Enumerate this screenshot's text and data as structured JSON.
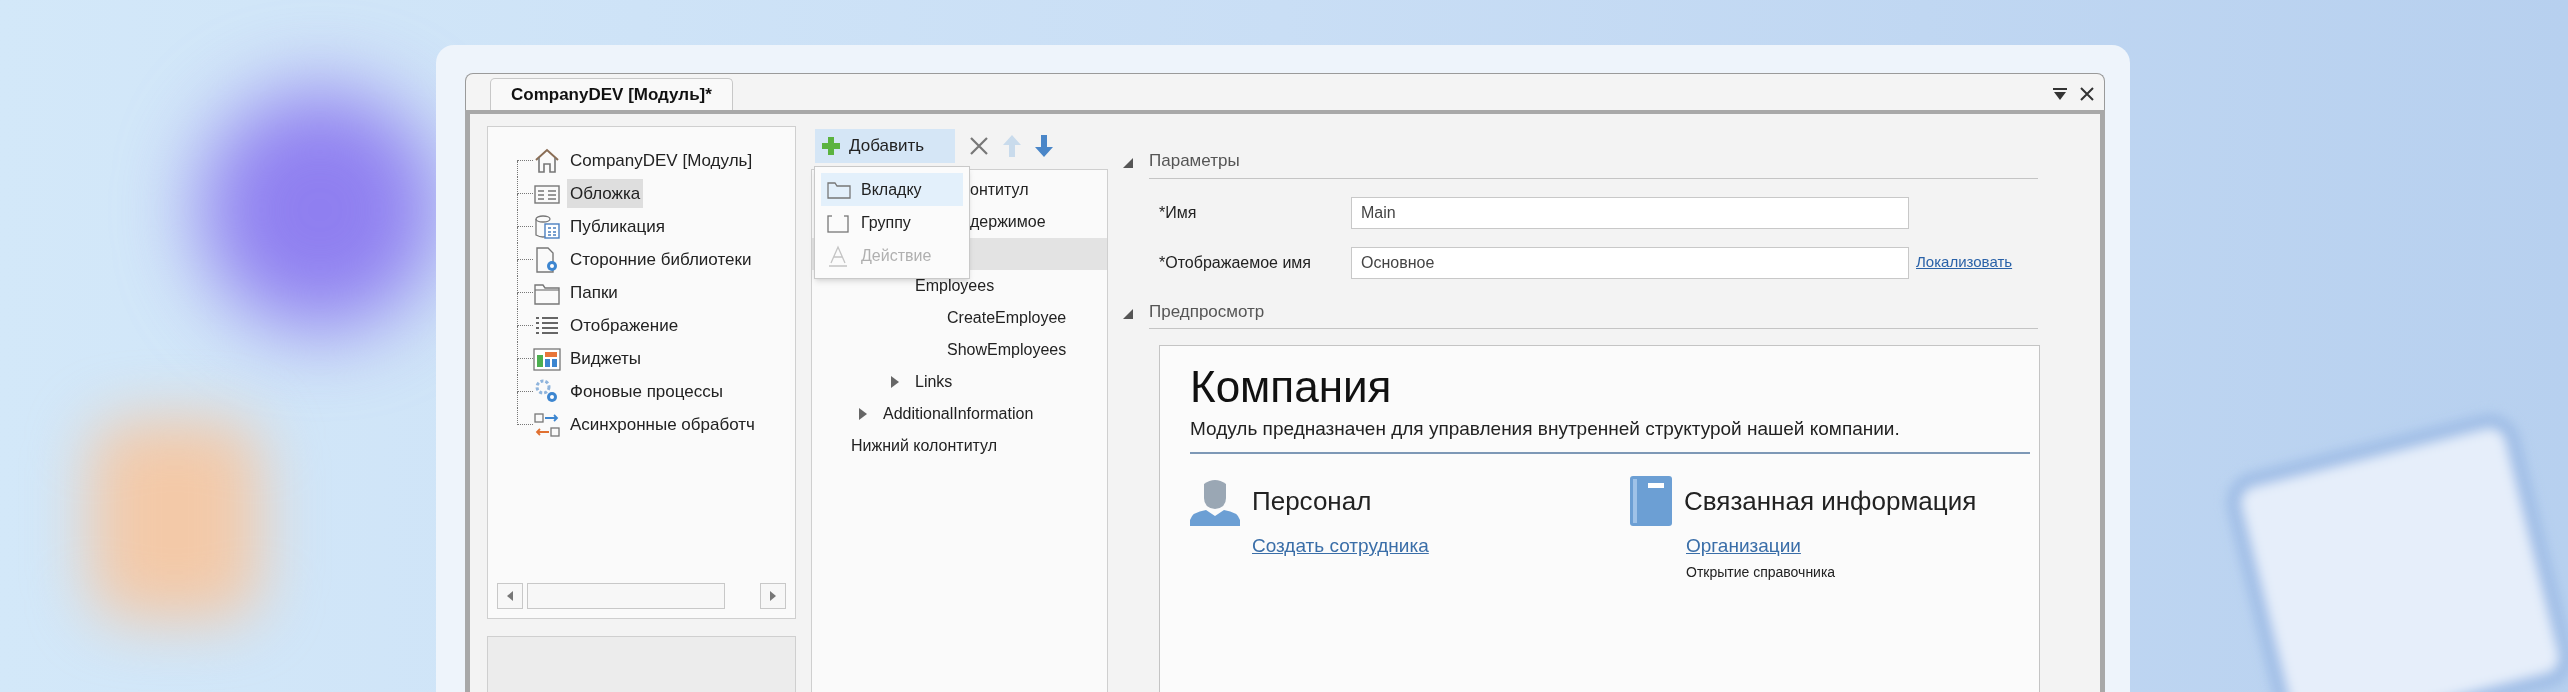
{
  "window": {
    "tab_title": "CompanyDEV [Модуль]*"
  },
  "module_tree": {
    "items": [
      {
        "label": "CompanyDEV [Модуль]",
        "kind": "module",
        "selected": false
      },
      {
        "label": "Обложка",
        "kind": "cover",
        "selected": true
      },
      {
        "label": "Публикация",
        "kind": "publication",
        "selected": false
      },
      {
        "label": "Сторонние библиотеки",
        "kind": "libraries",
        "selected": false
      },
      {
        "label": "Папки",
        "kind": "folders",
        "selected": false
      },
      {
        "label": "Отображение",
        "kind": "display",
        "selected": false
      },
      {
        "label": "Виджеты",
        "kind": "widgets",
        "selected": false
      },
      {
        "label": "Фоновые процессы",
        "kind": "background",
        "selected": false
      },
      {
        "label": "Асинхронные обработч",
        "kind": "async",
        "selected": false
      }
    ]
  },
  "toolbar": {
    "add_label": "Добавить",
    "buttons": [
      {
        "kind": "delete",
        "disabled": false
      },
      {
        "kind": "up",
        "disabled": true
      },
      {
        "kind": "down",
        "disabled": false
      }
    ]
  },
  "add_menu": {
    "items": [
      {
        "label": "Вкладку",
        "kind": "tab",
        "selected": true,
        "disabled": false
      },
      {
        "label": "Группу",
        "kind": "group",
        "selected": false,
        "disabled": false
      },
      {
        "label": "Действие",
        "kind": "action",
        "selected": false,
        "disabled": true
      }
    ]
  },
  "structure_tree": {
    "items": [
      {
        "label": "онтитул",
        "kind": "covered",
        "selected": false
      },
      {
        "label": "держимое",
        "kind": "covered",
        "selected": false,
        "children": [
          {
            "selected": true,
            "children": [
              {
                "label": "Employees",
                "selected": false,
                "children": [
                  {
                    "label": "CreateEmployee",
                    "selected": false
                  },
                  {
                    "label": "ShowEmployees",
                    "selected": false
                  }
                ]
              },
              {
                "label": "Links",
                "selected": false,
                "expanded": false
              }
            ]
          },
          {
            "label": "AdditionalInformation",
            "selected": false,
            "expanded": false
          }
        ]
      },
      {
        "label": "Нижний колонтитул",
        "selected": false
      }
    ]
  },
  "parameters": {
    "title": "Параметры",
    "expanded": true,
    "fields": [
      {
        "label": "*Имя",
        "value": "Main"
      },
      {
        "label": "*Отображаемое имя",
        "value": "Основное",
        "link": "Локализовать"
      }
    ]
  },
  "preview": {
    "title": "Предпросмотр",
    "expanded": true,
    "heading": "Компания",
    "description": "Модуль предназначен для управления внутренней структурой нашей компании.",
    "sections": [
      {
        "kind": "person",
        "title": "Персонал",
        "links": [
          "Создать сотрудника"
        ]
      },
      {
        "kind": "book",
        "title": "Связанная информация",
        "links": [
          "Организации"
        ],
        "note": "Открытие справочника"
      }
    ]
  }
}
